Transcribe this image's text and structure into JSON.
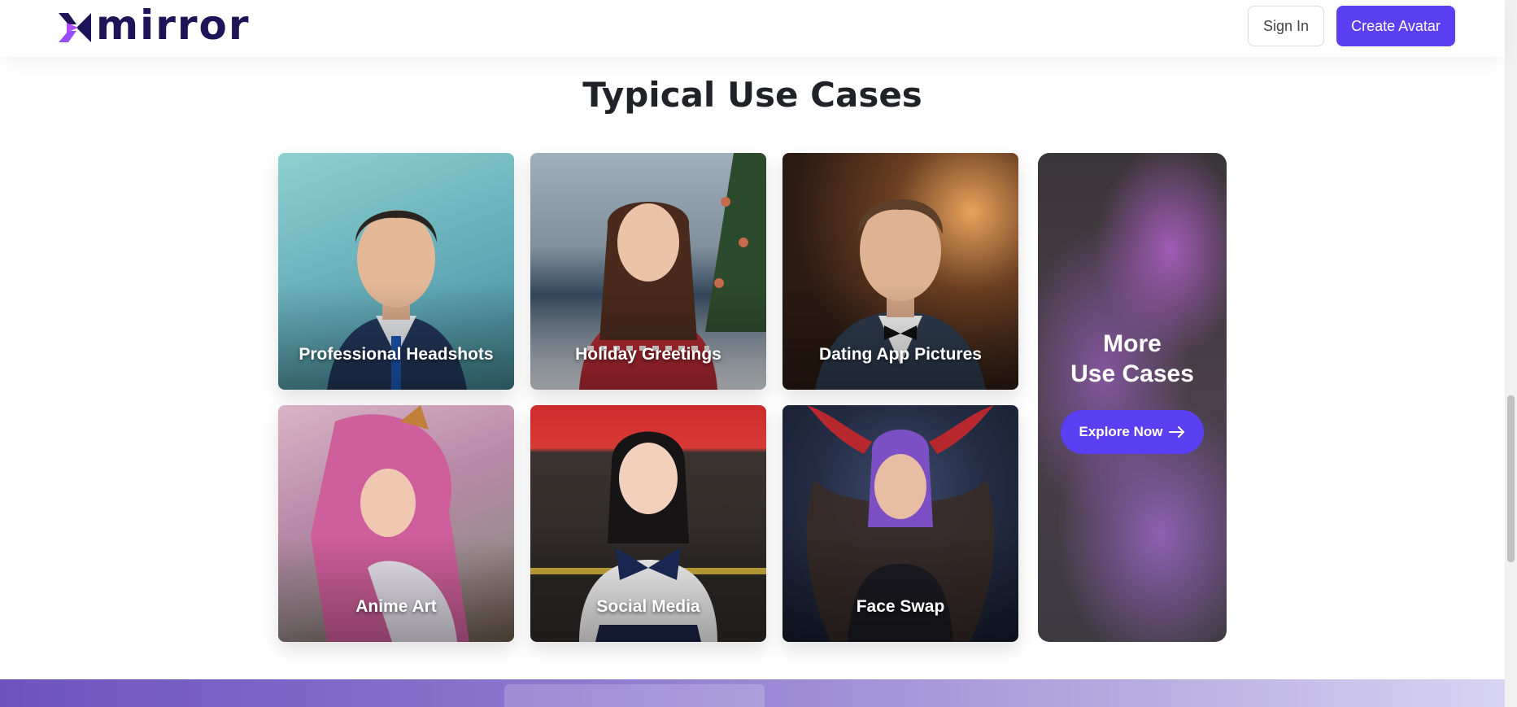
{
  "header": {
    "logo_text": "mirror",
    "sign_in_label": "Sign In",
    "create_avatar_label": "Create Avatar"
  },
  "use_cases": {
    "title": "Typical Use Cases",
    "cards": [
      {
        "label": "Professional Headshots"
      },
      {
        "label": "Holiday Greetings"
      },
      {
        "label": "Dating App Pictures"
      },
      {
        "label": "Anime Art"
      },
      {
        "label": "Social Media"
      },
      {
        "label": "Face Swap"
      }
    ],
    "more": {
      "title_line1": "More",
      "title_line2": "Use Cases",
      "button_label": "Explore Now"
    }
  },
  "colors": {
    "brand": "#5b3ff3",
    "logo_dark": "#1e1458",
    "heading": "#1f2328"
  }
}
